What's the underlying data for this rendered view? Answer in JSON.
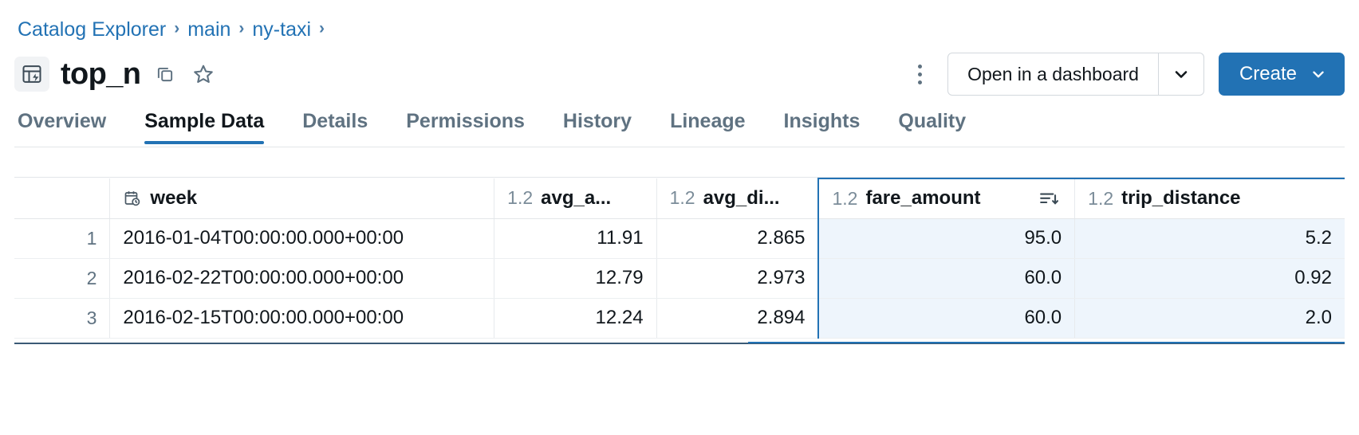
{
  "breadcrumb": {
    "items": [
      {
        "label": "Catalog Explorer"
      },
      {
        "label": "main"
      },
      {
        "label": "ny-taxi"
      }
    ],
    "separator": "›"
  },
  "header": {
    "title": "top_n",
    "object_icon": "materialized-view-icon",
    "copy_icon": "copy-icon",
    "favorite_icon": "star-icon",
    "kebab_icon": "more-vertical-icon",
    "open_dashboard_label": "Open in a dashboard",
    "open_dashboard_caret_icon": "chevron-down-icon",
    "create_label": "Create",
    "create_caret_icon": "chevron-down-icon",
    "primary_color": "#2272b4"
  },
  "tabs": [
    {
      "label": "Overview",
      "active": false
    },
    {
      "label": "Sample Data",
      "active": true
    },
    {
      "label": "Details",
      "active": false
    },
    {
      "label": "Permissions",
      "active": false
    },
    {
      "label": "History",
      "active": false
    },
    {
      "label": "Lineage",
      "active": false
    },
    {
      "label": "Insights",
      "active": false
    },
    {
      "label": "Quality",
      "active": false
    }
  ],
  "table": {
    "columns": [
      {
        "key": "idx",
        "label": "",
        "type": "",
        "icon": "",
        "selected": false
      },
      {
        "key": "week",
        "label": "week",
        "type": "",
        "icon": "timestamp-icon",
        "selected": false
      },
      {
        "key": "avg_a",
        "label": "avg_a...",
        "type": "1.2",
        "icon": "number-type-icon",
        "selected": false
      },
      {
        "key": "avg_di",
        "label": "avg_di...",
        "type": "1.2",
        "icon": "number-type-icon",
        "selected": false
      },
      {
        "key": "fare_amount",
        "label": "fare_amount",
        "type": "1.2",
        "icon": "number-type-icon",
        "selected": true,
        "sort": "descending",
        "sort_icon": "sort-descending-icon"
      },
      {
        "key": "trip_distance",
        "label": "trip_distance",
        "type": "1.2",
        "icon": "number-type-icon",
        "selected": true
      }
    ],
    "rows": [
      {
        "idx": "1",
        "week": "2016-01-04T00:00:00.000+00:00",
        "avg_a": "11.91",
        "avg_di": "2.865",
        "fare_amount": "95.0",
        "trip_distance": "5.2"
      },
      {
        "idx": "2",
        "week": "2016-02-22T00:00:00.000+00:00",
        "avg_a": "12.79",
        "avg_di": "2.973",
        "fare_amount": "60.0",
        "trip_distance": "0.92"
      },
      {
        "idx": "3",
        "week": "2016-02-15T00:00:00.000+00:00",
        "avg_a": "12.24",
        "avg_di": "2.894",
        "fare_amount": "60.0",
        "trip_distance": "2.0"
      }
    ],
    "selection_color": "#2272b4"
  }
}
